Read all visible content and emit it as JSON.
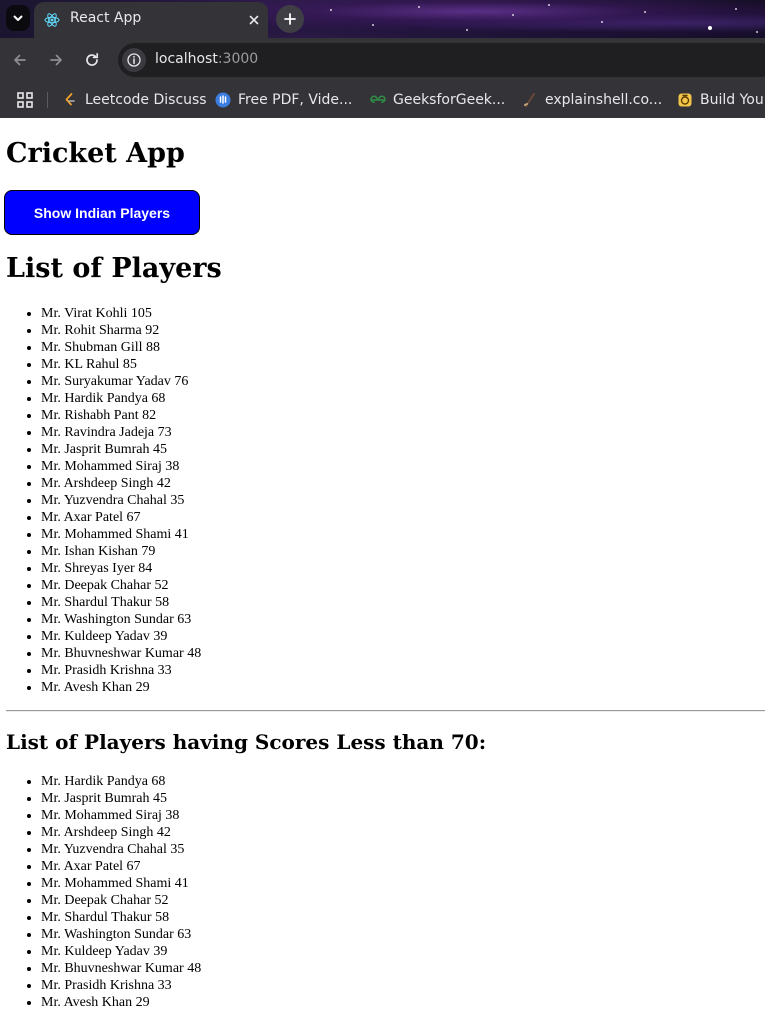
{
  "browser": {
    "tab_title": "React App",
    "url_host": "localhost",
    "url_port": ":3000",
    "bookmarks": [
      {
        "label": "Leetcode Discuss",
        "icon": "leetcode-icon"
      },
      {
        "label": "Free PDF, Vide...",
        "icon": "pdf-drive-icon"
      },
      {
        "label": "GeeksforGeek...",
        "icon": "geeksforgeeks-icon"
      },
      {
        "label": "explainshell.co...",
        "icon": "explainshell-icon"
      },
      {
        "label": "Build Your",
        "icon": "build-icon"
      }
    ]
  },
  "app": {
    "title": "Cricket App",
    "button_label": "Show Indian Players",
    "button_color": "#0000ff",
    "list_heading": "List of Players",
    "players": [
      "Mr. Virat Kohli 105",
      "Mr. Rohit Sharma 92",
      "Mr. Shubman Gill 88",
      "Mr. KL Rahul 85",
      "Mr. Suryakumar Yadav 76",
      "Mr. Hardik Pandya 68",
      "Mr. Rishabh Pant 82",
      "Mr. Ravindra Jadeja 73",
      "Mr. Jasprit Bumrah 45",
      "Mr. Mohammed Siraj 38",
      "Mr. Arshdeep Singh 42",
      "Mr. Yuzvendra Chahal 35",
      "Mr. Axar Patel 67",
      "Mr. Mohammed Shami 41",
      "Mr. Ishan Kishan 79",
      "Mr. Shreyas Iyer 84",
      "Mr. Deepak Chahar 52",
      "Mr. Shardul Thakur 58",
      "Mr. Washington Sundar 63",
      "Mr. Kuldeep Yadav 39",
      "Mr. Bhuvneshwar Kumar 48",
      "Mr. Prasidh Krishna 33",
      "Mr. Avesh Khan 29"
    ],
    "filtered_heading": "List of Players having Scores Less than 70:",
    "filtered_players": [
      "Mr. Hardik Pandya 68",
      "Mr. Jasprit Bumrah 45",
      "Mr. Mohammed Siraj 38",
      "Mr. Arshdeep Singh 42",
      "Mr. Yuzvendra Chahal 35",
      "Mr. Axar Patel 67",
      "Mr. Mohammed Shami 41",
      "Mr. Deepak Chahar 52",
      "Mr. Shardul Thakur 58",
      "Mr. Washington Sundar 63",
      "Mr. Kuldeep Yadav 39",
      "Mr. Bhuvneshwar Kumar 48",
      "Mr. Prasidh Krishna 33",
      "Mr. Avesh Khan 29"
    ]
  }
}
